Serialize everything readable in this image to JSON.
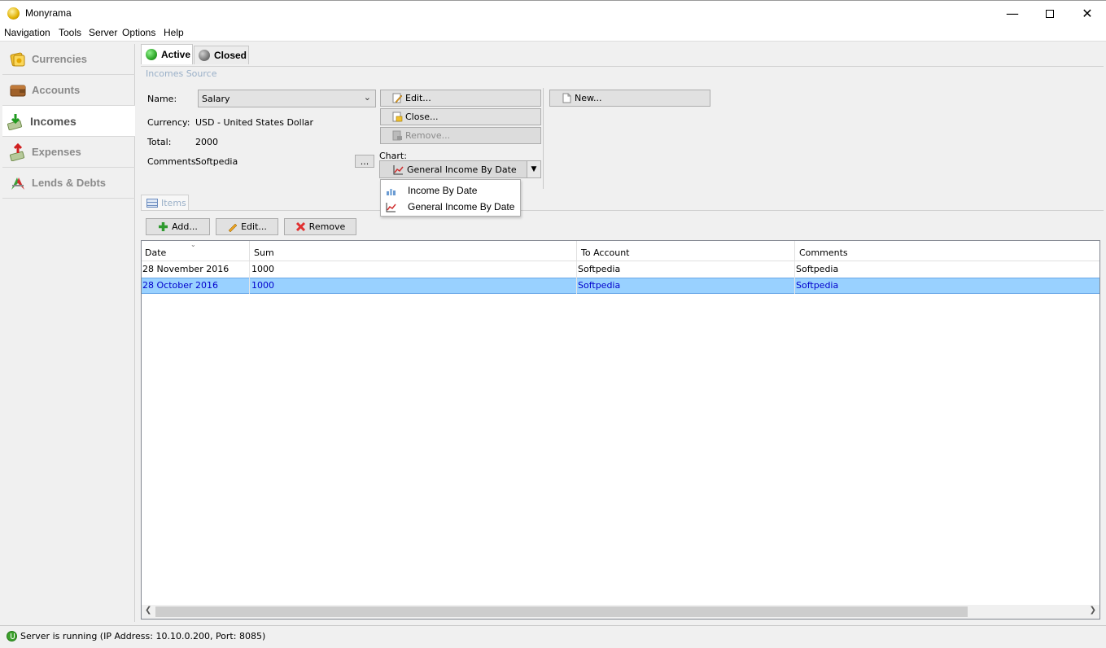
{
  "window": {
    "title": "Monyrama"
  },
  "menu": [
    "Navigation",
    "Tools",
    "Server",
    "Options",
    "Help"
  ],
  "sidebar": {
    "items": [
      {
        "label": "Currencies",
        "icon": "currencies-icon"
      },
      {
        "label": "Accounts",
        "icon": "accounts-icon"
      },
      {
        "label": "Incomes",
        "icon": "incomes-icon",
        "active": true
      },
      {
        "label": "Expenses",
        "icon": "expenses-icon"
      },
      {
        "label": "Lends & Debts",
        "icon": "lends-debts-icon"
      }
    ]
  },
  "tabs": {
    "active": "Active",
    "closed": "Closed"
  },
  "source": {
    "group_title": "Incomes Source",
    "name_label": "Name:",
    "name_value": "Salary",
    "currency_label": "Currency:",
    "currency_value": "USD - United States Dollar",
    "total_label": "Total:",
    "total_value": "2000",
    "comments_label": "Comments:",
    "comments_value": "Softpedia",
    "ellipsis_label": "...",
    "edit_label": "Edit...",
    "close_label": "Close...",
    "remove_label": "Remove...",
    "new_label": "New...",
    "chart_label": "Chart:",
    "chart_selected": "General Income By Date",
    "chart_options": [
      "Income By Date",
      "General Income By Date"
    ]
  },
  "items": {
    "tab_label": "Items",
    "add_label": "Add...",
    "edit_label": "Edit...",
    "remove_label": "Remove",
    "columns": [
      "Date",
      "Sum",
      "To Account",
      "Comments"
    ],
    "rows": [
      [
        "28 November 2016",
        "1000",
        "Softpedia",
        "Softpedia"
      ],
      [
        "28 October 2016",
        "1000",
        "Softpedia",
        "Softpedia"
      ]
    ],
    "selected_row": 1
  },
  "status": {
    "text": "Server is running (IP Address: 10.10.0.200, Port: 8085)"
  },
  "colors": {
    "active_dot": "#2fa82a",
    "closed_dot": "#7a7a7a",
    "selection": "#99d1ff",
    "selection_text": "#0000cc"
  }
}
